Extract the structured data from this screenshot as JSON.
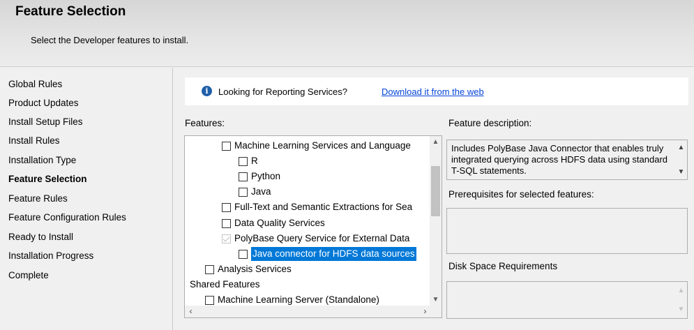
{
  "header": {
    "title": "Feature Selection",
    "subtitle": "Select the Developer features to install."
  },
  "nav": {
    "items": [
      {
        "label": "Global Rules",
        "active": false
      },
      {
        "label": "Product Updates",
        "active": false
      },
      {
        "label": "Install Setup Files",
        "active": false
      },
      {
        "label": "Install Rules",
        "active": false
      },
      {
        "label": "Installation Type",
        "active": false
      },
      {
        "label": "Feature Selection",
        "active": true
      },
      {
        "label": "Feature Rules",
        "active": false
      },
      {
        "label": "Feature Configuration Rules",
        "active": false
      },
      {
        "label": "Ready to Install",
        "active": false
      },
      {
        "label": "Installation Progress",
        "active": false
      },
      {
        "label": "Complete",
        "active": false
      }
    ]
  },
  "info": {
    "icon": "info-icon",
    "text": "Looking for Reporting Services?",
    "link": "Download it from the web"
  },
  "features": {
    "label": "Features:",
    "rows": [
      {
        "label": "Machine Learning Services and Language",
        "checked": false,
        "disabled": false,
        "selected": false
      },
      {
        "label": "R",
        "checked": false,
        "disabled": false,
        "selected": false
      },
      {
        "label": "Python",
        "checked": false,
        "disabled": false,
        "selected": false
      },
      {
        "label": "Java",
        "checked": false,
        "disabled": false,
        "selected": false
      },
      {
        "label": "Full-Text and Semantic Extractions for Sea",
        "checked": false,
        "disabled": false,
        "selected": false
      },
      {
        "label": "Data Quality Services",
        "checked": false,
        "disabled": false,
        "selected": false
      },
      {
        "label": "PolyBase Query Service for External Data",
        "checked": true,
        "disabled": true,
        "selected": false
      },
      {
        "label": "Java connector for HDFS data sources",
        "checked": false,
        "disabled": false,
        "selected": true
      },
      {
        "label": "Analysis Services",
        "checked": false,
        "disabled": false,
        "selected": false
      },
      {
        "label": "Shared Features",
        "group": true
      },
      {
        "label": "Machine Learning Server (Standalone)",
        "checked": false,
        "disabled": false,
        "selected": false
      }
    ]
  },
  "description": {
    "label": "Feature description:",
    "text": "Includes PolyBase Java Connector that enables truly integrated querying across HDFS data using standard T-SQL statements."
  },
  "prerequisites": {
    "label": "Prerequisites for selected features:"
  },
  "disk": {
    "label": "Disk Space Requirements"
  },
  "colors": {
    "selection": "#0078d7",
    "link": "#0645d6",
    "info_icon": "#1e5fa8"
  }
}
